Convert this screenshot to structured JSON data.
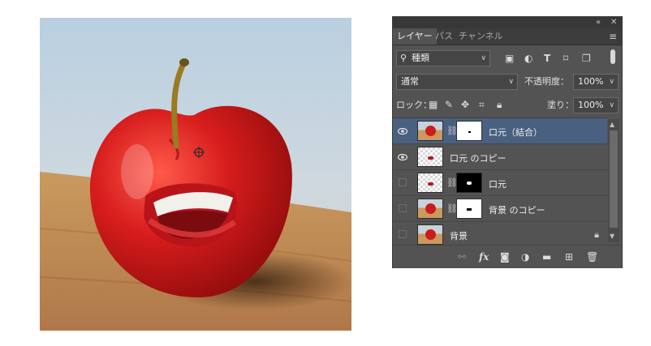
{
  "panel": {
    "tabs": [
      {
        "label": "レイヤー",
        "active": true
      },
      {
        "label": "パス",
        "active": false
      },
      {
        "label": "チャンネル",
        "active": false
      }
    ],
    "filter": {
      "value": "種類"
    },
    "blend_mode": {
      "value": "通常"
    },
    "opacity": {
      "label": "不透明度：",
      "value": "100%"
    },
    "lock_label": "ロック：",
    "fill": {
      "label": "塗り：",
      "value": "100%"
    },
    "layers": [
      {
        "name": "口元（結合）",
        "visible": true,
        "selected": true,
        "has_mask": true
      },
      {
        "name": "口元 のコピー",
        "visible": true,
        "selected": false,
        "has_mask": false
      },
      {
        "name": "口元",
        "visible": false,
        "selected": false,
        "has_mask": true
      },
      {
        "name": "背景 のコピー",
        "visible": false,
        "selected": false,
        "has_mask": true
      },
      {
        "name": "背景",
        "visible": false,
        "selected": false,
        "has_mask": false,
        "locked": true
      }
    ]
  },
  "colors": {
    "panel_bg": "#535353",
    "selected_layer": "#4a6080",
    "apple_red": "#d81f1f"
  },
  "icons": {
    "collapse": "double-chevron-icon",
    "close": "close-icon",
    "panel_menu": "hamburger-menu-icon",
    "search": "search-icon",
    "link": "link-icon",
    "fx": "fx-icon",
    "mask": "add-mask-icon",
    "adjustment": "adjustment-layer-icon",
    "group": "folder-icon",
    "new_layer": "new-layer-icon",
    "delete": "trash-icon"
  }
}
